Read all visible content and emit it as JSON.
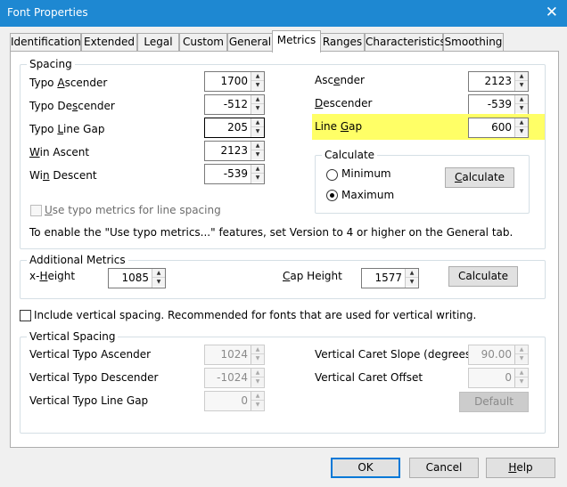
{
  "window": {
    "title": "Font Properties",
    "close": "✕"
  },
  "tabs": [
    {
      "label": "Identification"
    },
    {
      "label": "Extended"
    },
    {
      "label": "Legal"
    },
    {
      "label": "Custom"
    },
    {
      "label": "General"
    },
    {
      "label": "Metrics"
    },
    {
      "label": "Ranges"
    },
    {
      "label": "Characteristics"
    },
    {
      "label": "Smoothing"
    }
  ],
  "spacing": {
    "title": "Spacing",
    "typo_ascender": {
      "pre": "Typo ",
      "u": "A",
      "post": "scender",
      "value": "1700"
    },
    "typo_descender": {
      "pre": "Typo De",
      "u": "s",
      "post": "cender",
      "value": "-512"
    },
    "typo_line_gap": {
      "pre": "Typo ",
      "u": "L",
      "post": "ine Gap",
      "value": "205"
    },
    "win_ascent": {
      "pre": "",
      "u": "W",
      "post": "in Ascent",
      "value": "2123"
    },
    "win_descent": {
      "pre": "Wi",
      "u": "n",
      "post": " Descent",
      "value": "-539"
    },
    "ascender": {
      "pre": "Asc",
      "u": "e",
      "post": "nder",
      "value": "2123"
    },
    "descender": {
      "pre": "",
      "u": "D",
      "post": "escender",
      "value": "-539"
    },
    "line_gap": {
      "pre": "Line ",
      "u": "G",
      "post": "ap",
      "value": "600"
    },
    "calculate_group": "Calculate",
    "minimum": "Minimum",
    "maximum": "Maximum",
    "calculate_btn": {
      "u": "C",
      "post": "alculate"
    },
    "use_typo": {
      "u": "U",
      "post": "se typo metrics for line spacing"
    },
    "note": "To enable the \"Use typo metrics...\" features, set Version to 4 or higher on the General tab."
  },
  "additional": {
    "title": "Additional Metrics",
    "x_height": {
      "pre": "x-",
      "u": "H",
      "post": "eight",
      "value": "1085"
    },
    "cap_height": {
      "pre": "",
      "u": "C",
      "post": "ap Height",
      "value": "1577"
    },
    "calculate_btn": "Calculate"
  },
  "include_vertical": "Include vertical spacing. Recommended for fonts that are used for vertical writing.",
  "vertical": {
    "title": "Vertical Spacing",
    "typo_ascender": {
      "label": "Vertical Typo Ascender",
      "value": "1024"
    },
    "typo_descender": {
      "label": "Vertical Typo Descender",
      "value": "-1024"
    },
    "typo_line_gap": {
      "label": "Vertical Typo Line Gap",
      "value": "0"
    },
    "caret_slope": {
      "label": "Vertical Caret Slope (degrees)",
      "value": "90.00"
    },
    "caret_offset": {
      "label": "Vertical Caret Offset",
      "value": "0"
    },
    "default_btn": "Default"
  },
  "footer": {
    "ok": "OK",
    "cancel": "Cancel",
    "help": {
      "u": "H",
      "post": "elp"
    }
  },
  "colors": {
    "titlebar": "#1e88d2",
    "highlight": "#ffff66",
    "focus": "#0078d7"
  }
}
